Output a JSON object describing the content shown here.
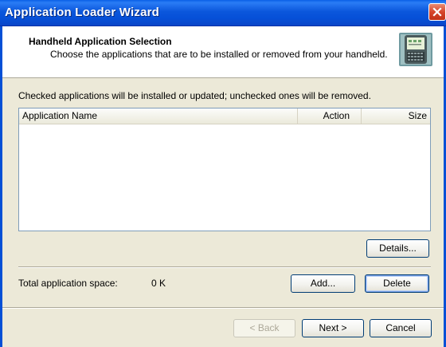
{
  "window": {
    "title": "Application Loader Wizard",
    "close_label": "close"
  },
  "header": {
    "title": "Handheld Application Selection",
    "subtitle": "Choose the applications that are to be installed or removed from your handheld."
  },
  "instructions": "Checked applications will be installed or updated; unchecked ones will be removed.",
  "list": {
    "columns": [
      "Application Name",
      "Action",
      "Size"
    ],
    "rows": []
  },
  "buttons": {
    "details": "Details...",
    "add": "Add...",
    "delete": "Delete",
    "back": "< Back",
    "next": "Next >",
    "cancel": "Cancel"
  },
  "space": {
    "label": "Total application space:",
    "value": "0 K"
  },
  "colors": {
    "titlebar": "#0a5fe6",
    "dialog_bg": "#ece9d8",
    "button_border": "#003c74"
  },
  "icons": {
    "header": "handheld-device-icon",
    "close": "close-icon"
  }
}
